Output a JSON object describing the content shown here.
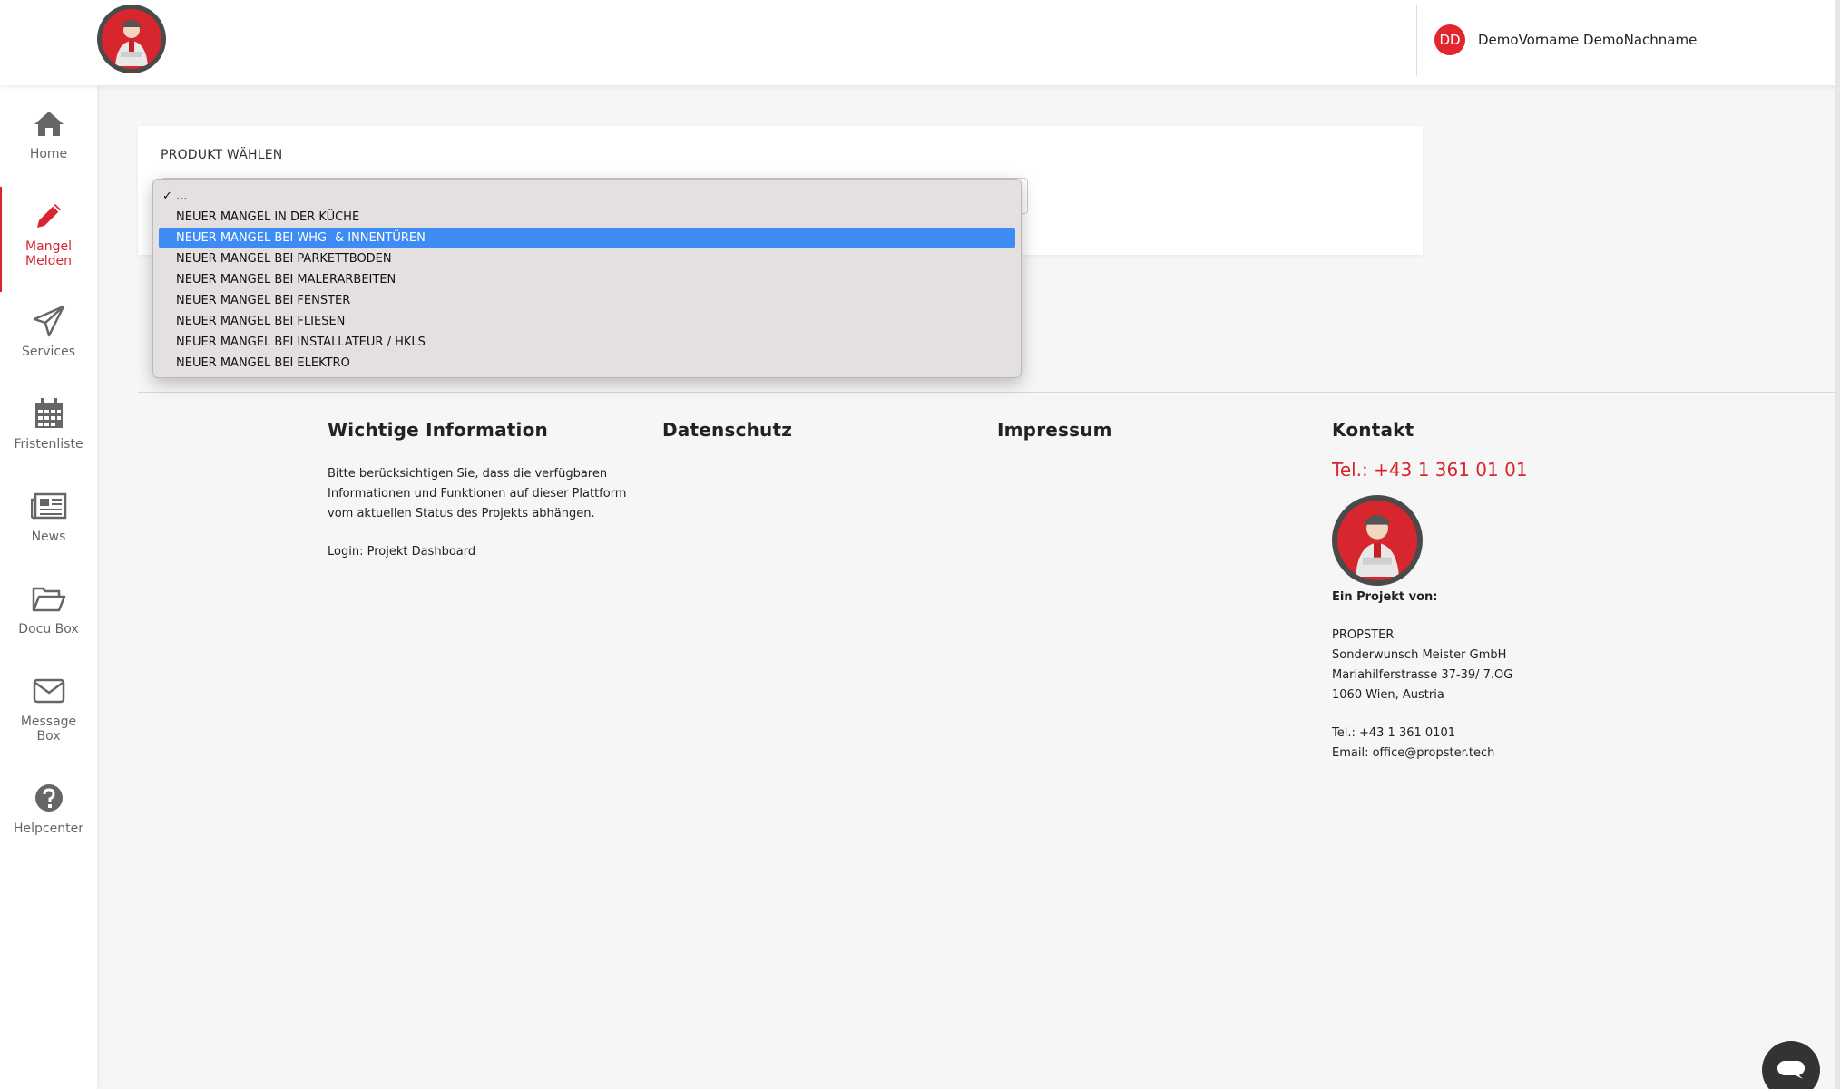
{
  "header": {
    "user_initials": "DD",
    "user_name": "DemoVorname DemoNachname"
  },
  "sidebar": {
    "items": [
      {
        "label": "Home",
        "icon": "home-icon"
      },
      {
        "label": "Mangel\nMelden",
        "icon": "pencil-icon",
        "active": true
      },
      {
        "label": "Services",
        "icon": "paper-plane-icon"
      },
      {
        "label": "Fristenliste",
        "icon": "calendar-icon"
      },
      {
        "label": "News",
        "icon": "newspaper-icon"
      },
      {
        "label": "Docu Box",
        "icon": "folder-icon"
      },
      {
        "label": "Message\nBox",
        "icon": "envelope-icon"
      },
      {
        "label": "Helpcenter",
        "icon": "question-icon"
      }
    ]
  },
  "product": {
    "label": "PRODUKT WÄHLEN",
    "options": [
      "...",
      "NEUER MANGEL IN DER KÜCHE",
      "NEUER MANGEL BEI WHG- & INNENTÜREN",
      "NEUER MANGEL BEI PARKETTBODEN",
      "NEUER MANGEL BEI MALERARBEITEN",
      "NEUER MANGEL BEI FENSTER",
      "NEUER MANGEL BEI FLIESEN",
      "NEUER MANGEL BEI INSTALLATEUR / HKLS",
      "NEUER MANGEL BEI ELEKTRO"
    ],
    "checked_index": 0,
    "highlighted_index": 2
  },
  "footer": {
    "info": {
      "title": "Wichtige Information",
      "text_lines": [
        "Bitte berücksichtigen Sie, dass die verfügbaren",
        "Informationen und Funktionen auf dieser Plattform",
        "vom aktuellen Status des Projekts abhängen."
      ],
      "login": "Login: Projekt Dashboard"
    },
    "privacy_title": "Datenschutz",
    "imprint_title": "Impressum",
    "contact": {
      "title": "Kontakt",
      "phone": "Tel.: +43 1 361 01 01",
      "project_by": "Ein Projekt von:",
      "address_lines": [
        "PROPSTER",
        "Sonderwunsch Meister GmbH",
        "Mariahilferstrasse 37-39/ 7.OG",
        "1060 Wien, Austria"
      ],
      "tel": "Tel.: +43 1 361 0101",
      "email": "Email: office@propster.tech"
    }
  },
  "colors": {
    "accent": "#d7262e",
    "selection": "#3d8bf3"
  }
}
